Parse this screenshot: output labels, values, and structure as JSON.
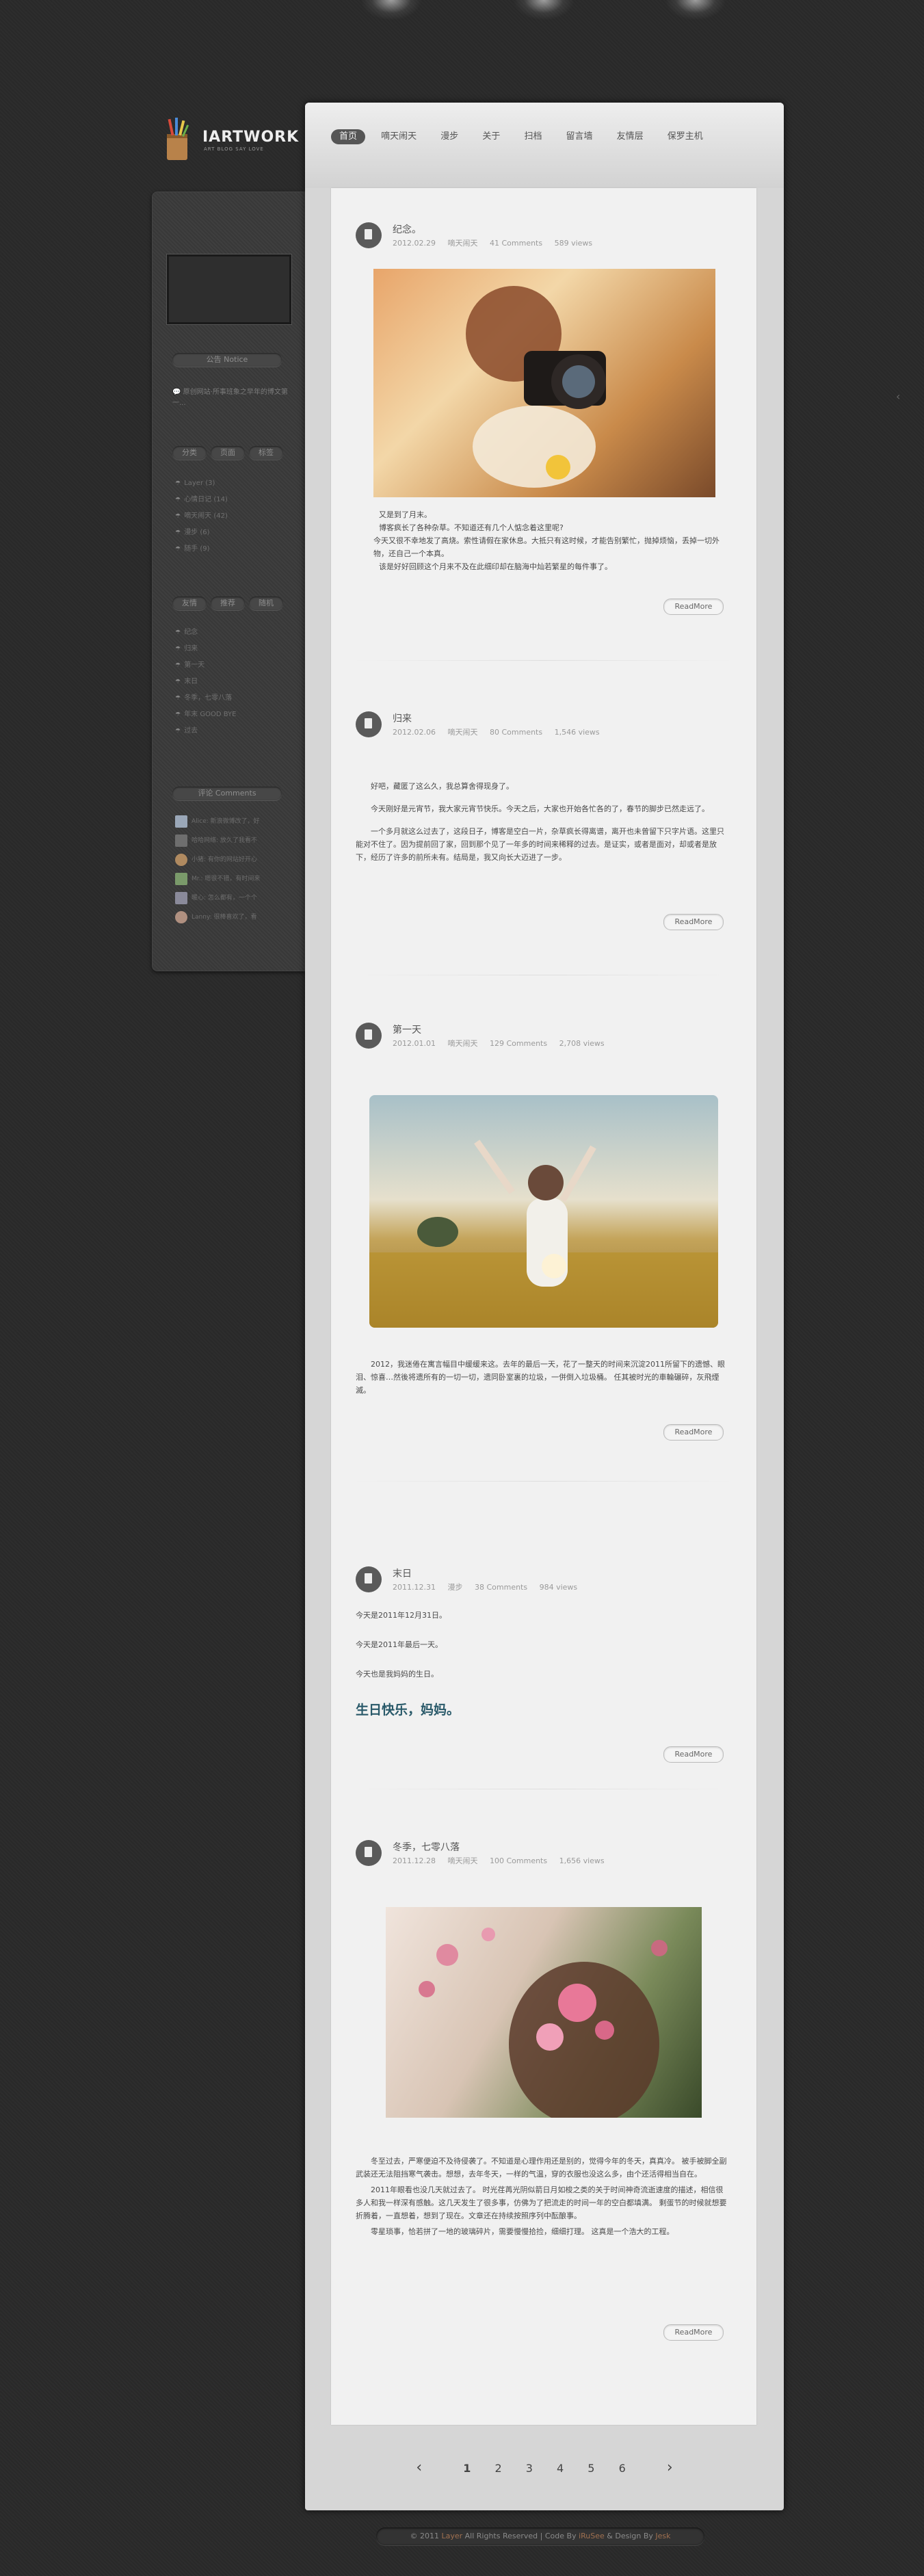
{
  "brand": {
    "name": "IARTWORK",
    "tagline": "ART BLOG SAY LOVE"
  },
  "nav": {
    "items": [
      "首页",
      "嘀天闹天",
      "漫步",
      "关于",
      "扫档",
      "留言墙",
      "友情层",
      "保罗主机"
    ]
  },
  "sidebar": {
    "notice_tab": "公告  Notice",
    "notice_text": "原创网站·所事班象之早年的博文第一...",
    "tabs1": [
      "分类",
      "页面",
      "标签"
    ],
    "categories": [
      "Layer (3)",
      "心情日记 (14)",
      "嘀天闹天 (42)",
      "漫步 (6)",
      "随手 (9)"
    ],
    "tabs2": [
      "友情",
      "推荐",
      "随机"
    ],
    "links": [
      "纪念",
      "归来",
      "第一天",
      "末日",
      "冬季，七零八落",
      "年末 GOOD BYE",
      "过去"
    ],
    "comments_tab": "评论  Comments",
    "comments": [
      {
        "text": "Alice: 新浪微博改了，好",
        "color": "#9aa7b8"
      },
      {
        "text": "哈哈网络: 放久了我看不",
        "color": "#6e6e6e"
      },
      {
        "text": "小猪: 有你的网站好开心",
        "color": "#b08a60"
      },
      {
        "text": "Mr.: 嗯很不错，有时间来",
        "color": "#7a9a6a"
      },
      {
        "text": "暖心: 怎么都有，一个个",
        "color": "#8a8a9a"
      },
      {
        "text": "Lanny: 很棒喜欢了，看",
        "color": "#b09080"
      }
    ]
  },
  "posts": [
    {
      "title": "纪念。",
      "date": "2012.02.29",
      "category": "嘀天闹天",
      "comments": "41 Comments",
      "views": "589 views",
      "image": "girl-with-camera-photo",
      "text": [
        "又是到了月末。",
        "博客疯长了各种杂草。不知道还有几个人惦念着这里呢?",
        "今天又很不幸地发了高烧。索性请假在家休息。大抵只有这时候，才能告别繁忙，抛掉烦恼，丢掉一切外物，还自己一个本真。",
        "该是好好回顾这个月来不及在此细印却在脑海中灿若繁星的每件事了。"
      ],
      "readmore": "ReadMore"
    },
    {
      "title": "归来",
      "date": "2012.02.06",
      "category": "嘀天闹天",
      "comments": "80 Comments",
      "views": "1,546 views",
      "text": [
        "好吧，藏匿了这么久，我总算舍得现身了。",
        "今天刚好是元宵节，我大家元宵节快乐。今天之后，大家也开始各忙各的了，春节的脚步已然走远了。",
        "一个多月就这么过去了，这段日子，博客是空白一片，杂草疯长得离谱，离开也未曾留下只字片语。这里只能对不住了。因为提前回了家，回到那个见了一年多的时间来稀释的过去。是证实，或者是面对，却或者是放下，经历了许多的前所未有。结局是，我又向长大迈进了一步。"
      ],
      "readmore": "ReadMore"
    },
    {
      "title": "第一天",
      "date": "2012.01.01",
      "category": "嘀天闹天",
      "comments": "129 Comments",
      "views": "2,708 views",
      "image": "girl-in-flower-field-photo",
      "text": [
        "2012，我迷倦在寓言幅目中缓缓来这。去年的最后一天，花了一整天的时间来沉淀2011所留下的遗憾、眼泪、惊喜…然後将遗所有的一切一切，遗同卧室裏的垃圾，一併倒入垃圾桶。 任其被时光的車輪碾碎，灰飛煙滅。"
      ],
      "readmore": "ReadMore"
    },
    {
      "title": "末日",
      "date": "2011.12.31",
      "category": "漫步",
      "comments": "38 Comments",
      "views": "984 views",
      "text": [
        "今天是2011年12月31日。",
        "今天是2011年最后一天。",
        "今天也是我妈妈的生日。"
      ],
      "highlight": "生日快乐，妈妈。",
      "readmore": "ReadMore"
    },
    {
      "title": "冬季，七零八落",
      "date": "2011.12.28",
      "category": "嘀天闹天",
      "comments": "100 Comments",
      "views": "1,656 views",
      "image": "girl-with-pink-flowers-photo",
      "text": [
        "冬至过去，严寒便迫不及待侵袭了。不知道是心理作用还是别的，觉得今年的冬天，真真冷。 被手被脚全副武装还无法阻挡寒气袭击。想想，去年冬天，一样的气温，穿的衣服也没这么多，由个还活得相当自在。",
        "2011年眼看也没几天就过去了。 时光荏苒光阴似箭日月如梭之类的关于时间神奇流逝速度的描述，相信很多人和我一样深有感触。这几天发生了很多事，仿佛为了把流走的时间一年的空白都填满。 剩蛋节的时候就想要折腾着，一直想着，想到了现在。文章还在持续按照序列中酝酿事。",
        "零星琐事，恰若拼了一地的玻璃碎片，需要慢慢拾捡，细细打理。 这真是一个浩大的工程。"
      ],
      "readmore": "ReadMore"
    }
  ],
  "pager": {
    "prev": "‹",
    "pages": [
      "1",
      "2",
      "3",
      "4",
      "5",
      "6"
    ],
    "current": "1",
    "next": "›"
  },
  "footer": {
    "copyright": "© 2011",
    "site": "Layer",
    "rights": "All Rights Reserved",
    "code_by": "Code By",
    "coder": "iRuSee",
    "design_by": "& Design By",
    "designer": "Jesk"
  }
}
